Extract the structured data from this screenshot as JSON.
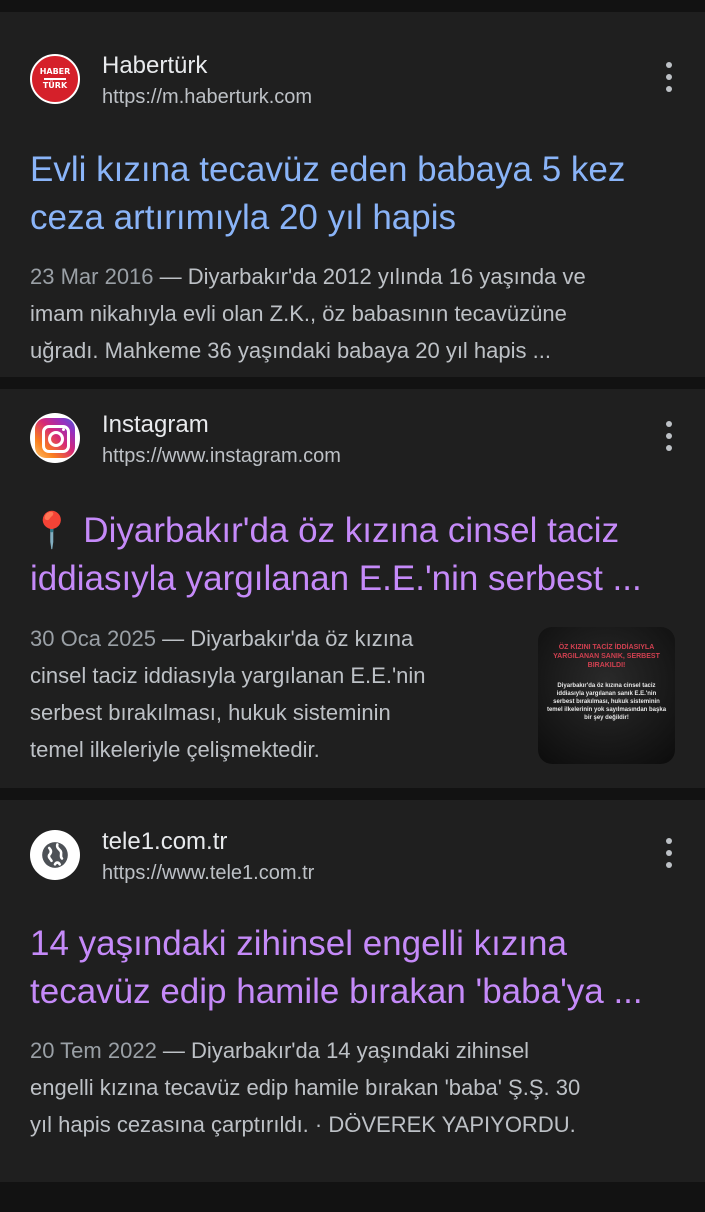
{
  "results": [
    {
      "source_name": "Habertürk",
      "source_url": "https://m.haberturk.com",
      "logo_text_top": "HABER",
      "logo_text_bottom": "TÜRK",
      "title_line1": "Evli kızına tecavüz eden babaya 5 kez",
      "title_line2": "ceza artırımıyla 20 yıl hapis",
      "date": "23 Mar 2016",
      "snippet_line1": " — Diyarbakır'da 2012 yılında 16 yaşında ve",
      "snippet_line2": "imam nikahıyla evli olan Z.K., öz babasının tecavüzüne",
      "snippet_line3": "uğradı. Mahkeme 36 yaşındaki babaya 20 yıl hapis ..."
    },
    {
      "source_name": "Instagram",
      "source_url": "https://www.instagram.com",
      "title_line1": "📍 Diyarbakır'da öz kızına cinsel taciz",
      "title_line2": "iddiasıyla yargılanan E.E.'nin serbest ...",
      "date": "30 Oca 2025",
      "snippet_line1": " — Diyarbakır'da öz kızına",
      "snippet_line2": "cinsel taciz iddiasıyla yargılanan E.E.'nin",
      "snippet_line3": "serbest bırakılması, hukuk sisteminin",
      "snippet_line4": "temel ilkeleriyle çelişmektedir.",
      "thumb_heading": "ÖZ KIZINI TACİZ İDDİASIYLA YARGILANAN SANIK, SERBEST BIRAKILDI!",
      "thumb_body": "Diyarbakır'da öz kızına cinsel taciz iddiasıyla yargılanan sanık E.E.'nin serbest bırakılması, hukuk sisteminin temel ilkelerinin yok sayılmasından başka bir şey değildir!"
    },
    {
      "source_name": "tele1.com.tr",
      "source_url": "https://www.tele1.com.tr",
      "title_line1": "14 yaşındaki zihinsel engelli kızına",
      "title_line2": "tecavüz edip hamile bırakan 'baba'ya ...",
      "date": "20 Tem 2022",
      "snippet_line1": " — Diyarbakır'da 14 yaşındaki zihinsel",
      "snippet_line2": "engelli kızına tecavüz edip hamile bırakan 'baba' Ş.Ş. 30",
      "snippet_line3": "yıl hapis cezasına çarptırıldı. · DÖVEREK YAPIYORDU."
    }
  ],
  "colors": {
    "link_unvisited": "#8ab4f8",
    "link_visited": "#c58af9",
    "card_bg": "#1f1f1f",
    "page_bg": "#121212"
  },
  "icons": [
    "haberturk-logo",
    "instagram-logo",
    "globe-icon",
    "more-vert-icon"
  ]
}
